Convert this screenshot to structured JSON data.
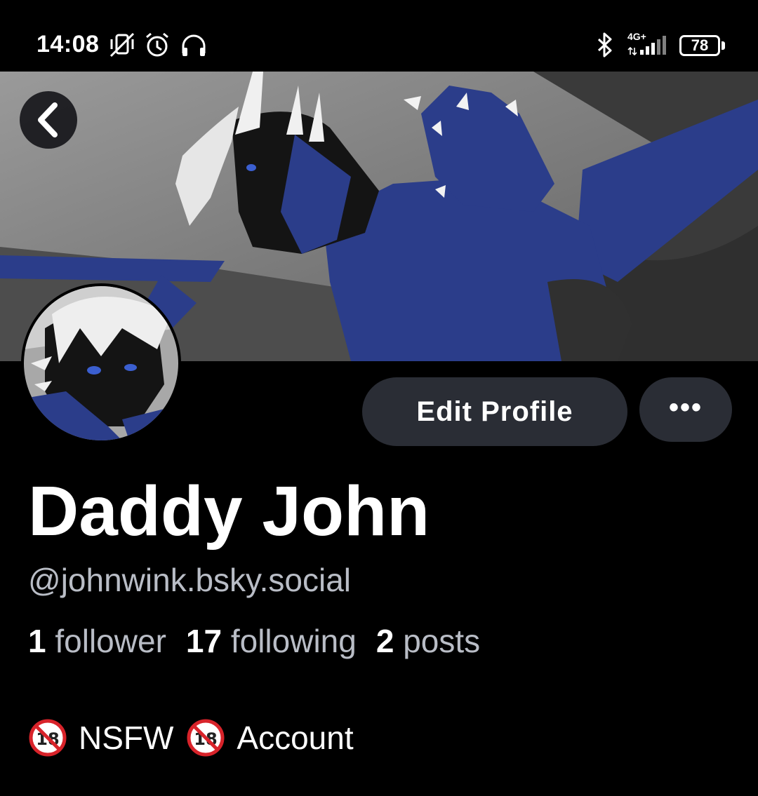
{
  "status_bar": {
    "time": "14:08",
    "icons": [
      "vibrate-off-icon",
      "alarm-icon",
      "headphones-icon",
      "bluetooth-icon",
      "signal-4g-icon"
    ],
    "network": "4G+",
    "battery": "78"
  },
  "header": {
    "back_icon": "chevron-left-icon"
  },
  "profile": {
    "display_name": "Daddy John",
    "handle": "@johnwink.bsky.social",
    "stats": {
      "followers_count": "1",
      "followers_label": "follower",
      "following_count": "17",
      "following_label": "following",
      "posts_count": "2",
      "posts_label": "posts"
    },
    "bio": {
      "emoji_1": "no-under-18-icon",
      "word_1": "NSFW",
      "emoji_2": "no-under-18-icon",
      "word_2": "Account"
    }
  },
  "actions": {
    "edit_profile_label": "Edit Profile",
    "more_label": "•••"
  },
  "colors": {
    "background": "#000000",
    "button_bg": "#2a2d35",
    "secondary_text": "#b9bdc6",
    "dragon_blue": "#2b3d8a"
  }
}
